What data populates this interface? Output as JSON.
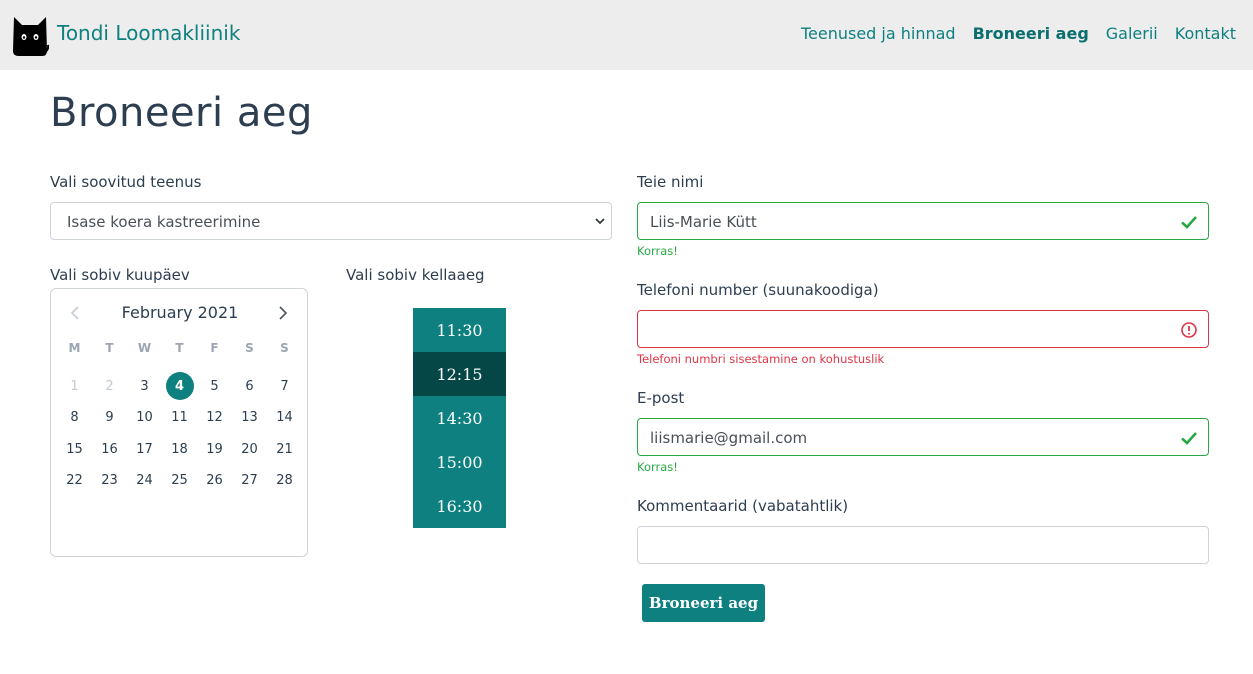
{
  "navbar": {
    "brand": "Tondi Loomakliinik",
    "logo_icon": "black-cat-icon",
    "links": [
      {
        "label": "Teenused ja hinnad",
        "active": false
      },
      {
        "label": "Broneeri aeg",
        "active": true
      },
      {
        "label": "Galerii",
        "active": false
      },
      {
        "label": "Kontakt",
        "active": false
      }
    ]
  },
  "page_title": "Broneeri aeg",
  "service": {
    "label": "Vali soovitud teenus",
    "selected": "Isase koera kastreerimine"
  },
  "calendar": {
    "label": "Vali sobiv kuupäev",
    "month": "February 2021",
    "weekdays": [
      "M",
      "T",
      "W",
      "T",
      "F",
      "S",
      "S"
    ],
    "days": [
      {
        "d": "1",
        "state": "disabled"
      },
      {
        "d": "2",
        "state": "disabled"
      },
      {
        "d": "3",
        "state": "normal"
      },
      {
        "d": "4",
        "state": "selected"
      },
      {
        "d": "5",
        "state": "normal"
      },
      {
        "d": "6",
        "state": "normal"
      },
      {
        "d": "7",
        "state": "normal"
      },
      {
        "d": "8",
        "state": "normal"
      },
      {
        "d": "9",
        "state": "normal"
      },
      {
        "d": "10",
        "state": "normal"
      },
      {
        "d": "11",
        "state": "normal"
      },
      {
        "d": "12",
        "state": "normal"
      },
      {
        "d": "13",
        "state": "normal"
      },
      {
        "d": "14",
        "state": "normal"
      },
      {
        "d": "15",
        "state": "normal"
      },
      {
        "d": "16",
        "state": "normal"
      },
      {
        "d": "17",
        "state": "normal"
      },
      {
        "d": "18",
        "state": "normal"
      },
      {
        "d": "19",
        "state": "normal"
      },
      {
        "d": "20",
        "state": "normal"
      },
      {
        "d": "21",
        "state": "normal"
      },
      {
        "d": "22",
        "state": "normal"
      },
      {
        "d": "23",
        "state": "normal"
      },
      {
        "d": "24",
        "state": "normal"
      },
      {
        "d": "25",
        "state": "normal"
      },
      {
        "d": "26",
        "state": "normal"
      },
      {
        "d": "27",
        "state": "normal"
      },
      {
        "d": "28",
        "state": "normal"
      }
    ]
  },
  "times": {
    "label": "Vali sobiv kellaaeg",
    "slots": [
      {
        "time": "11:30",
        "active": false
      },
      {
        "time": "12:15",
        "active": true
      },
      {
        "time": "14:30",
        "active": false
      },
      {
        "time": "15:00",
        "active": false
      },
      {
        "time": "16:30",
        "active": false
      }
    ]
  },
  "form": {
    "name": {
      "label": "Teie nimi",
      "value": "Liis-Marie Kütt",
      "feedback": "Korras!",
      "state": "valid"
    },
    "phone": {
      "label": "Telefoni number (suunakoodiga)",
      "value": "",
      "feedback": "Telefoni numbri sisestamine on kohustuslik",
      "state": "invalid"
    },
    "email": {
      "label": "E-post",
      "value": "liismarie@gmail.com",
      "feedback": "Korras!",
      "state": "valid"
    },
    "comments": {
      "label": "Kommentaarid (vabatahtlik)",
      "value": ""
    },
    "submit_label": "Broneeri aeg"
  },
  "colors": {
    "accent": "#0e8080",
    "accent_dark": "#054746",
    "valid": "#28a745",
    "invalid": "#dc3545",
    "navbar_bg": "#ededed"
  }
}
